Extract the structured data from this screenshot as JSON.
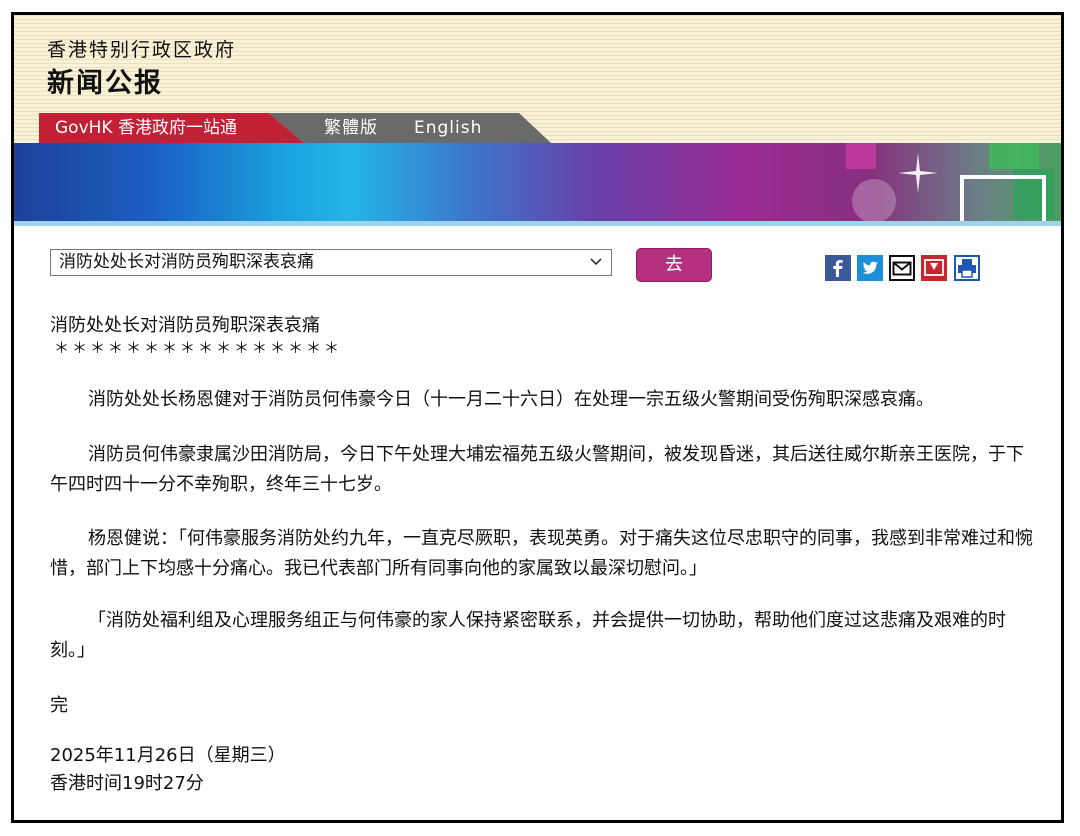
{
  "header": {
    "org_name": "香港特别行政区政府",
    "title": "新闻公报"
  },
  "tabs": {
    "govhk": "GovHK 香港政府一站通",
    "traditional": "繁體版",
    "english": "English"
  },
  "controls": {
    "selected_option": "消防处处长对消防员殉职深表哀痛",
    "go_label": "去"
  },
  "share_icons": [
    "facebook-icon",
    "twitter-icon",
    "email-icon",
    "bookmark-icon",
    "print-icon"
  ],
  "article": {
    "headline": "消防处处长对消防员殉职深表哀痛",
    "stars": "＊＊＊＊＊＊＊＊＊＊＊＊＊＊＊＊",
    "paragraphs": [
      "消防处处长杨恩健对于消防员何伟豪今日（十一月二十六日）在处理一宗五级火警期间受伤殉职深感哀痛。",
      "消防员何伟豪隶属沙田消防局，今日下午处理大埔宏福苑五级火警期间，被发现昏迷，其后送往威尔斯亲王医院，于下午四时四十一分不幸殉职，终年三十七岁。",
      "杨恩健说：「何伟豪服务消防处约九年，一直克尽厥职，表现英勇。对于痛失这位尽忠职守的同事，我感到非常难过和惋惜，部门上下均感十分痛心。我已代表部门所有同事向他的家属致以最深切慰问。」",
      "「消防处福利组及心理服务组正与何伟豪的家人保持紧密联系，并会提供一切协助，帮助他们度过这悲痛及艰难的时刻。」"
    ],
    "end": "完",
    "date": "2025年11月26日（星期三）",
    "time": "香港时间19时27分"
  },
  "colors": {
    "govhk_tab": "#c22035",
    "go_button": "#b5307f",
    "header_bg": "#f8f3d8"
  }
}
